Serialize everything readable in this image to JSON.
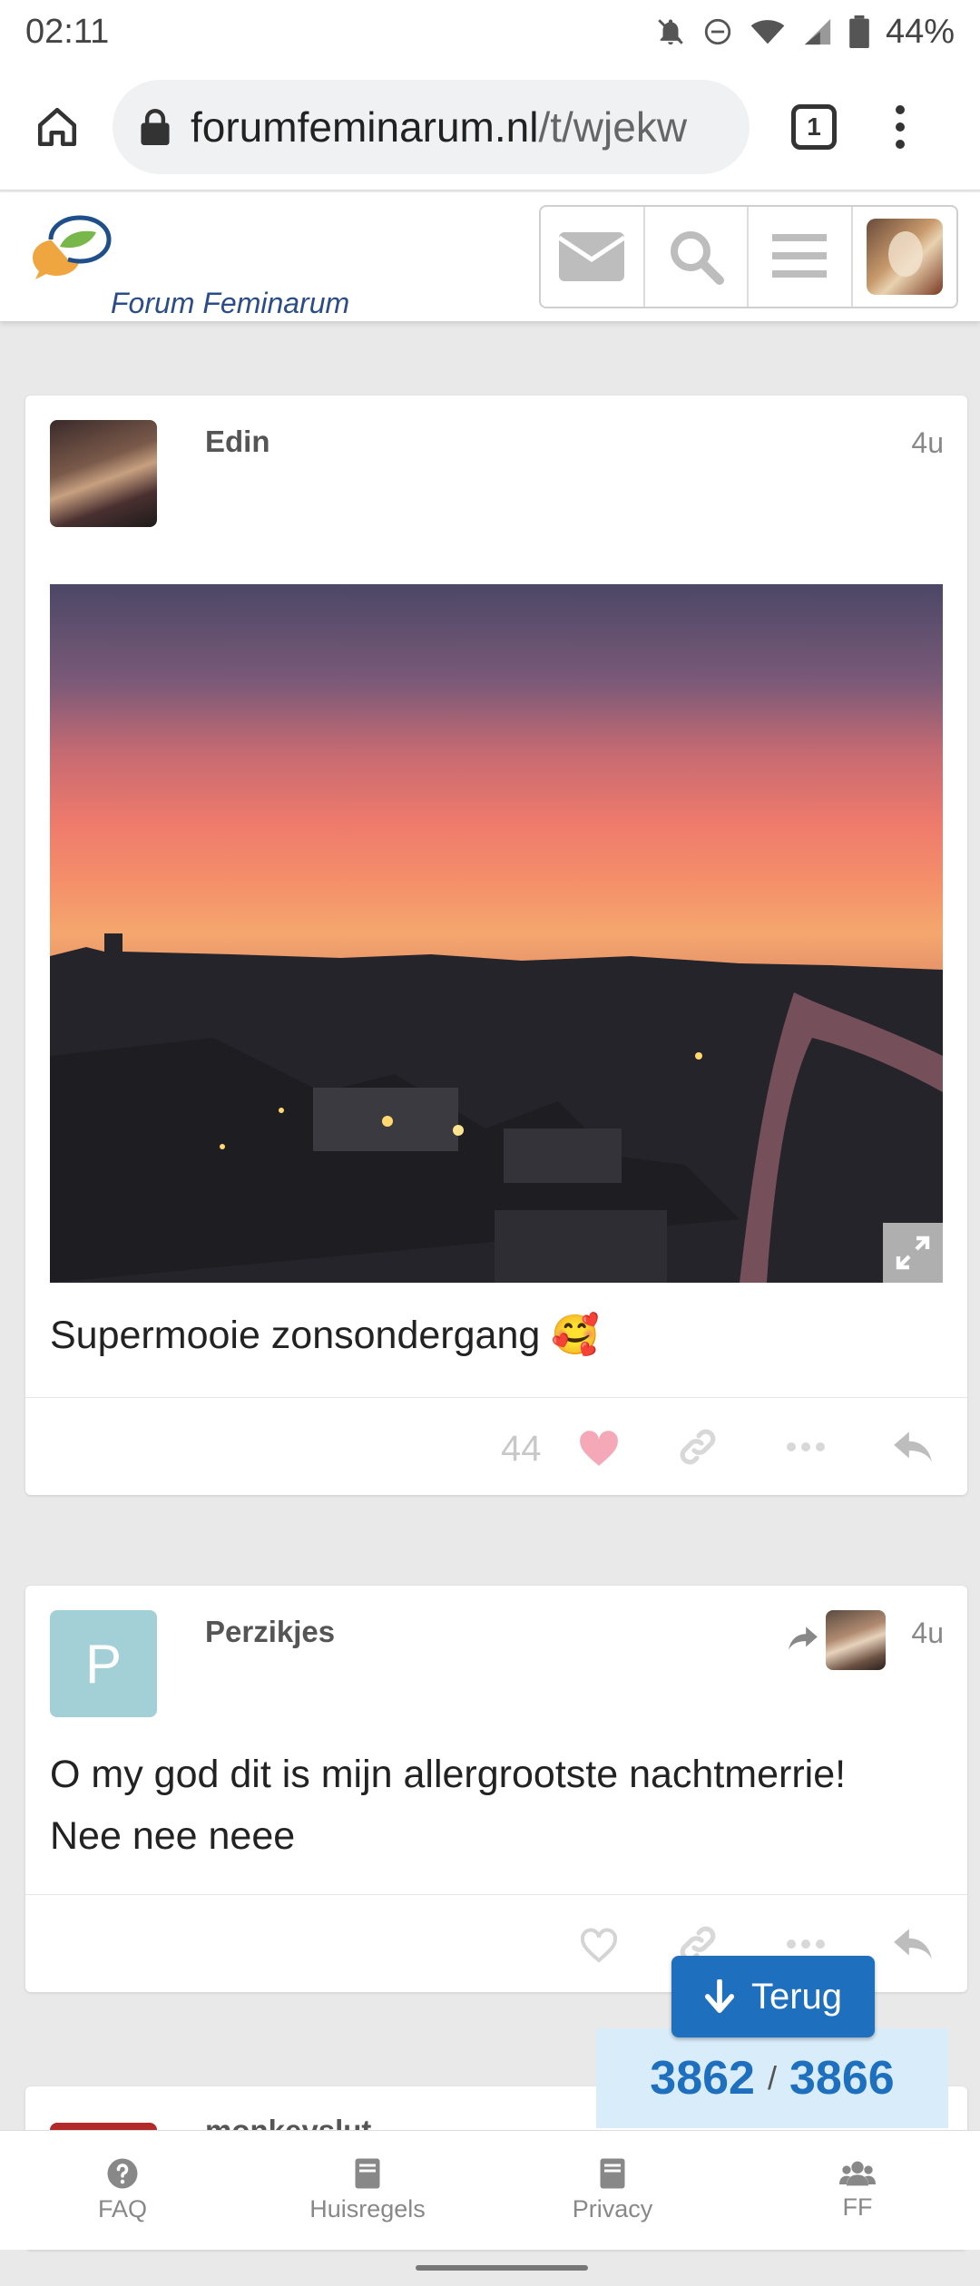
{
  "status_bar": {
    "time": "02:11",
    "battery": "44%"
  },
  "browser": {
    "url_domain": "forumfeminarum.nl",
    "url_path": "/t/wjekw",
    "tab_count": "1"
  },
  "site": {
    "logo_text": "Forum Feminarum"
  },
  "posts": [
    {
      "author": "Edin",
      "time": "4u",
      "text": "Supermooie zonsondergang 🥰",
      "like_count": "44"
    },
    {
      "author": "Perzikjes",
      "avatar_letter": "P",
      "time": "4u",
      "text_line1": "O my god dit is mijn allergrootste nachtmerrie!",
      "text_line2": "Nee nee neee"
    },
    {
      "author": "monkeyslut"
    }
  ],
  "floating": {
    "back_label": "Terug",
    "current_post": "3862",
    "separator": "/",
    "total_posts": "3866"
  },
  "bottom_nav": [
    {
      "label": "FAQ",
      "icon": "question-circle-icon"
    },
    {
      "label": "Huisregels",
      "icon": "book-icon"
    },
    {
      "label": "Privacy",
      "icon": "book-icon"
    },
    {
      "label": "FF",
      "icon": "users-icon"
    }
  ],
  "colors": {
    "accent": "#1f6fbf",
    "like": "#f4a8b8",
    "progress_bg": "#d8ecf9",
    "avatar_p": "#a3cfd6"
  }
}
